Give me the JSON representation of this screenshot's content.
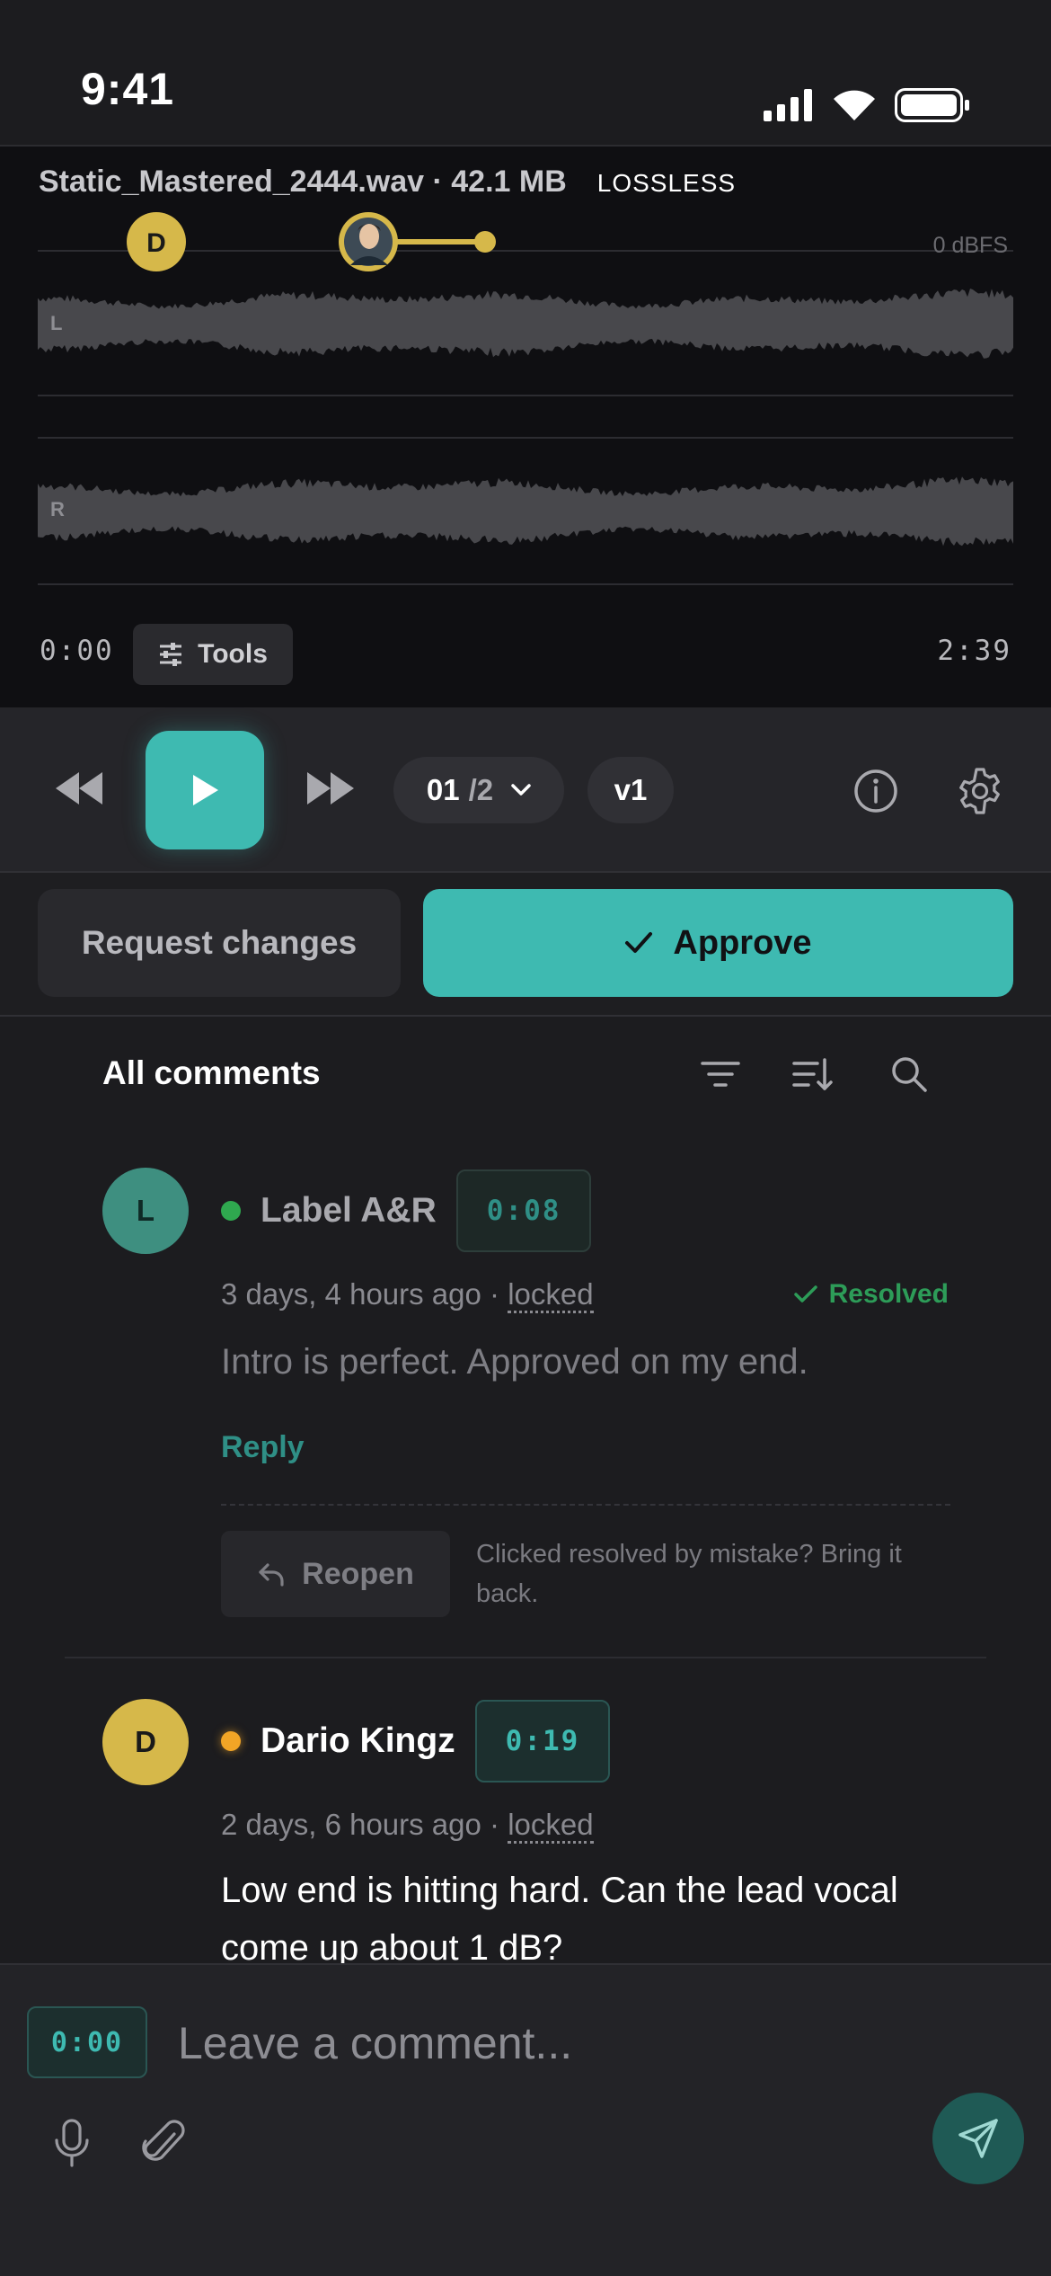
{
  "status_bar": {
    "time": "9:41"
  },
  "player": {
    "file_name": "Static_Mastered_2444.wav · 42.1 MB",
    "quality_badge": "LOSSLESS",
    "level_label": "0 dBFS",
    "channel_left": "L",
    "channel_right": "R",
    "marker_initial": "D",
    "time_start": "0:00",
    "time_end": "2:39",
    "tools_label": "Tools"
  },
  "transport": {
    "track_current": "01",
    "track_total": "/2",
    "version": "v1"
  },
  "decision": {
    "request_changes_label": "Request changes",
    "approve_label": "Approve"
  },
  "comments": {
    "title": "All comments",
    "items": [
      {
        "avatar_initial": "L",
        "author": "Label A&R",
        "timestamp": "0:08",
        "meta_prefix": "3 days, 4 hours ago · ",
        "meta_locked": "locked",
        "status": "Resolved",
        "body": "Intro is perfect. Approved on my end.",
        "reply_label": "Reply",
        "reopen_label": "Reopen",
        "reopen_hint": "Clicked resolved by mistake? Bring it back."
      },
      {
        "avatar_initial": "D",
        "author": "Dario Kingz",
        "timestamp": "0:19",
        "meta_prefix": "2 days, 6 hours ago · ",
        "meta_locked": "locked",
        "body": "Low end is hitting hard. Can the lead vocal come up about 1 dB?"
      }
    ]
  },
  "composer": {
    "timestamp": "0:00",
    "placeholder": "Leave a comment..."
  },
  "colors": {
    "accent": "#3ebab1",
    "resolved": "#2d9c58",
    "marker_gold": "#d6b84a",
    "online_green": "#2fa84f",
    "away_orange": "#f2a526"
  }
}
